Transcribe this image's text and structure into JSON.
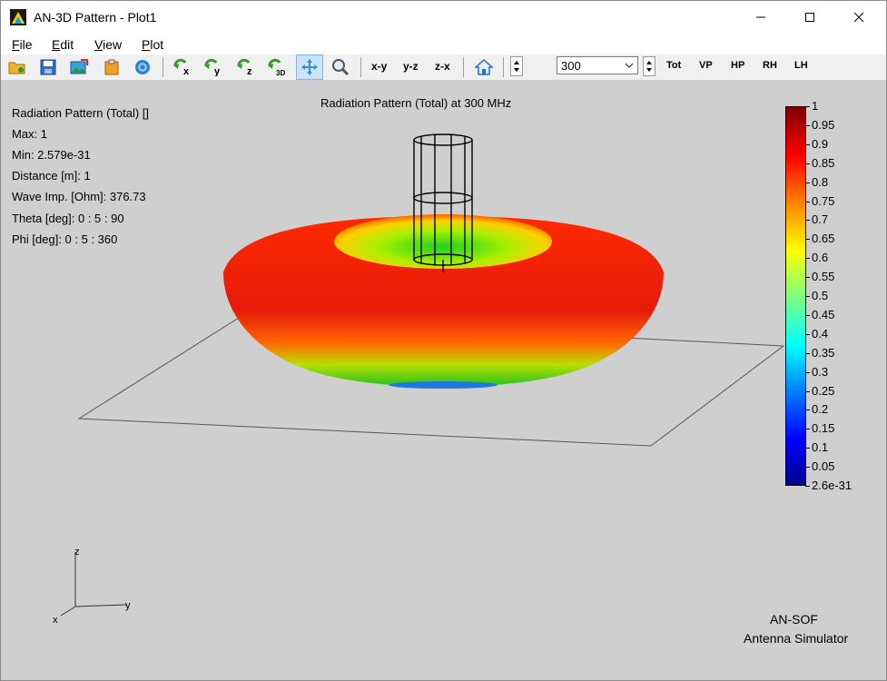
{
  "window": {
    "title": "AN-3D Pattern - Plot1"
  },
  "menu": {
    "items": [
      "File",
      "Edit",
      "View",
      "Plot"
    ]
  },
  "toolbar": {
    "view_xy": "x-y",
    "view_yz": "y-z",
    "view_zx": "z-x",
    "frequency_value": "300",
    "pol_tot": "Tot",
    "pol_vp": "VP",
    "pol_hp": "HP",
    "pol_rh": "RH",
    "pol_lh": "LH"
  },
  "plot": {
    "title": "Radiation Pattern (Total) at 300 MHz",
    "info": [
      "Radiation Pattern (Total) []",
      "Max: 1",
      "Min: 2.579e-31",
      "Distance [m]: 1",
      "Wave Imp. [Ohm]: 376.73",
      "Theta [deg]: 0 : 5 : 90",
      "Phi [deg]: 0 : 5 : 360"
    ],
    "colorbar_labels": [
      "1",
      "0.95",
      "0.9",
      "0.85",
      "0.8",
      "0.75",
      "0.7",
      "0.65",
      "0.6",
      "0.55",
      "0.5",
      "0.45",
      "0.4",
      "0.35",
      "0.3",
      "0.25",
      "0.2",
      "0.15",
      "0.1",
      "0.05",
      "2.6e-31"
    ],
    "axes": {
      "z": "z",
      "y": "y",
      "x": "x"
    },
    "brand_line1": "AN-SOF",
    "brand_line2": "Antenna Simulator"
  },
  "colors": {
    "high": "#ff0000",
    "mid": "#00ff00",
    "low": "#0000ff",
    "background": "#cfcfcf"
  }
}
